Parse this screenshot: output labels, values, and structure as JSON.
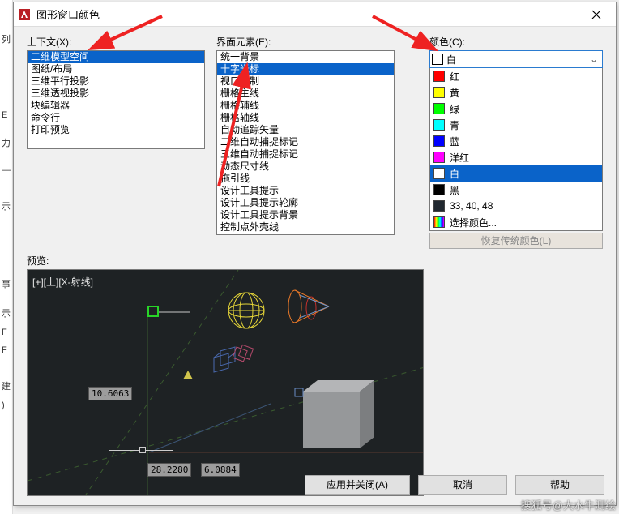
{
  "title": "图形窗口颜色",
  "labels": {
    "context": "上下文(X):",
    "element": "界面元素(E):",
    "color": "颜色(C):",
    "preview": "预览:"
  },
  "context_items": [
    "二维模型空间",
    "图纸/布局",
    "三维平行投影",
    "三维透视投影",
    "块编辑器",
    "命令行",
    "打印预览"
  ],
  "context_selected": 0,
  "element_items": [
    "统一背景",
    "十字光标",
    "视口控制",
    "栅格主线",
    "栅格辅线",
    "栅格轴线",
    "自动追踪矢量",
    "二维自动捕捉标记",
    "三维自动捕捉标记",
    "动态尺寸线",
    "拖引线",
    "设计工具提示",
    "设计工具提示轮廓",
    "设计工具提示背景",
    "控制点外壳线"
  ],
  "element_selected": 1,
  "color_selected": {
    "label": "白",
    "hex": "#ffffff"
  },
  "color_options": [
    {
      "label": "红",
      "hex": "#ff0000"
    },
    {
      "label": "黄",
      "hex": "#ffff00"
    },
    {
      "label": "绿",
      "hex": "#00ff00"
    },
    {
      "label": "青",
      "hex": "#00ffff"
    },
    {
      "label": "蓝",
      "hex": "#0000ff"
    },
    {
      "label": "洋红",
      "hex": "#ff00ff"
    },
    {
      "label": "白",
      "hex": "#ffffff"
    },
    {
      "label": "黑",
      "hex": "#000000"
    },
    {
      "label": "33, 40, 48",
      "hex": "#212830"
    },
    {
      "label": "选择颜色...",
      "rainbow": true
    }
  ],
  "color_dropdown_selected": 6,
  "restore_button": "恢复传统颜色(L)",
  "preview_data": {
    "view_label": "[+][上][X-射线]",
    "dim1": "10.6063",
    "dim2": "28.2280",
    "dim3": "6.0884"
  },
  "buttons": {
    "apply": "应用并关闭(A)",
    "cancel": "取消",
    "help": "帮助"
  },
  "watermark": "搜狐号@大水牛测绘"
}
